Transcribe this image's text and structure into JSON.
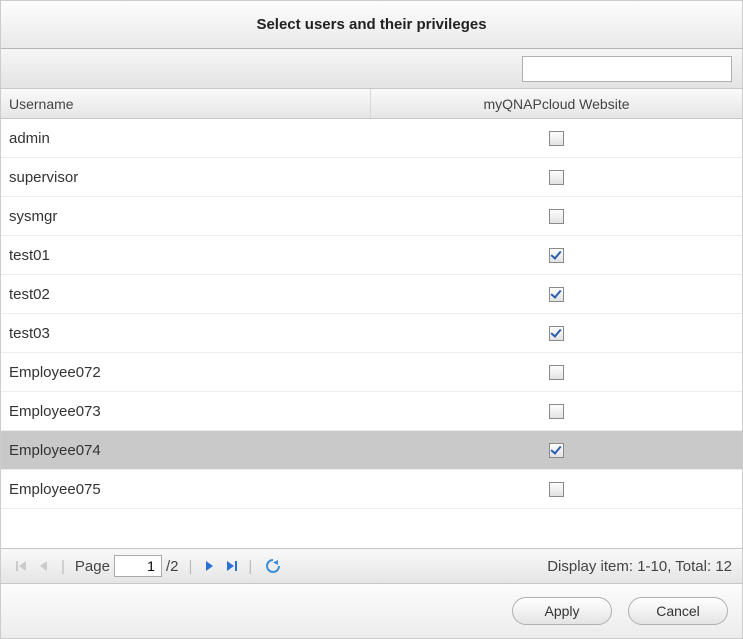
{
  "title": "Select users and their privileges",
  "search": {
    "value": "",
    "placeholder": ""
  },
  "columns": {
    "username": "Username",
    "privilege": "myQNAPcloud Website"
  },
  "rows": [
    {
      "username": "admin",
      "checked": false,
      "selected": false
    },
    {
      "username": "supervisor",
      "checked": false,
      "selected": false
    },
    {
      "username": "sysmgr",
      "checked": false,
      "selected": false
    },
    {
      "username": "test01",
      "checked": true,
      "selected": false
    },
    {
      "username": "test02",
      "checked": true,
      "selected": false
    },
    {
      "username": "test03",
      "checked": true,
      "selected": false
    },
    {
      "username": "Employee072",
      "checked": false,
      "selected": false
    },
    {
      "username": "Employee073",
      "checked": false,
      "selected": false
    },
    {
      "username": "Employee074",
      "checked": true,
      "selected": true
    },
    {
      "username": "Employee075",
      "checked": false,
      "selected": false
    }
  ],
  "pager": {
    "page_label": "Page",
    "current_page": "1",
    "total_pages_text": "/2",
    "display_text": "Display item: 1-10, Total: 12"
  },
  "buttons": {
    "apply": "Apply",
    "cancel": "Cancel"
  }
}
